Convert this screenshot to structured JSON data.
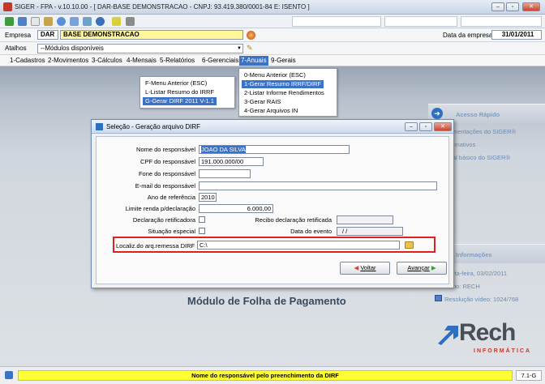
{
  "window": {
    "title": "SIGER - FPA - v.10.10.00 - [ DAR-BASE DEMONSTRACAO - CNPJ: 93.419.380/0001-84 E: ISENTO ]"
  },
  "empresa": {
    "label": "Empresa",
    "code": "DAR",
    "name": "BASE DEMONSTRACAO",
    "date_label": "Data da empresa",
    "date_value": "31/01/2011"
  },
  "atalhos": {
    "label": "Atalhos",
    "value": "--Módulos disponíveis"
  },
  "menu": [
    {
      "label": "1-Cadastros"
    },
    {
      "label": "2-Movimentos"
    },
    {
      "label": "3-Cálculos"
    },
    {
      "label": "4-Mensais"
    },
    {
      "label": "5-Relatórios"
    },
    {
      "label": "6-Gerenciais"
    },
    {
      "label": "7-Anuais"
    },
    {
      "label": "9-Gerais"
    }
  ],
  "submenu_left": [
    {
      "label": "F-Menu Anterior (ESC)"
    },
    {
      "label": "L-Listar Resumo do IRRF"
    },
    {
      "label": "G-Gerar DIRF 2011 V-1.1"
    }
  ],
  "submenu_right": [
    {
      "label": "0-Menu Anterior (ESC)"
    },
    {
      "label": "1-Gerar Resumo IRRF/DIRF"
    },
    {
      "label": "2-Listar Informe Rendimentos"
    },
    {
      "label": "3-Gerar RAIS"
    },
    {
      "label": "4-Gerar Arquivos IN"
    }
  ],
  "right_panel": {
    "quick_access": "Acesso Rápido",
    "items": [
      "mentações do SIGER®",
      "rmativos",
      "al básico do SIGER®"
    ],
    "info_title": "Informações",
    "info_items": [
      "rta-feira, 03/02/2011",
      "rio: RECH",
      "Resolução vídeo: 1024/768"
    ]
  },
  "module_title": "Módulo de Folha de Pagamento",
  "brand": {
    "name": "Rech",
    "tagline": "INFORMÁTICA"
  },
  "dialog": {
    "title": "Seleção - Geração arquivo DIRF",
    "fields": {
      "nome_label": "Nome do responsável",
      "nome_value": "JOAO DA SILVA",
      "cpf_label": "CPF do responsável",
      "cpf_value": "191.000.000/00",
      "fone_label": "Fone do responsável",
      "fone_value": "",
      "email_label": "E-mail do responsável",
      "email_value": "",
      "ano_label": "Ano de referência",
      "ano_value": "2010",
      "limite_label": "Limite renda p/declaração",
      "limite_value": "6.000,00",
      "retificadora_label": "Declaração retificadora",
      "recibo_label": "Recibo declaração retificada",
      "recibo_value": "",
      "situacao_label": "Situação especial",
      "data_evento_label": "Data do evento",
      "data_evento_value": "/  /",
      "local_label": "Localiz.do arq.remessa DIRF",
      "local_value": "C:\\"
    },
    "buttons": {
      "voltar": "Voltar",
      "avancar": "Avançar"
    }
  },
  "status": {
    "message": "Nome do responsável pelo preenchimento da DIRF",
    "version": "7.1-G"
  }
}
